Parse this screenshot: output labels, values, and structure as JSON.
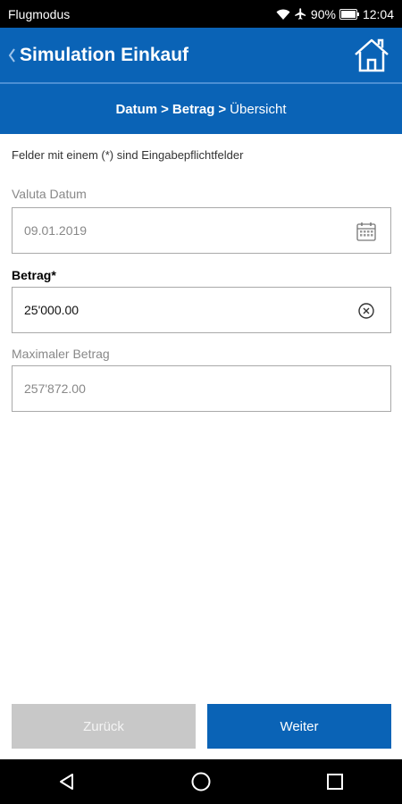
{
  "status_bar": {
    "carrier": "Flugmodus",
    "battery": "90%",
    "time": "12:04"
  },
  "header": {
    "title": "Simulation Einkauf"
  },
  "breadcrumb": {
    "step1": "Datum",
    "sep1": ">",
    "step2": "Betrag",
    "sep2": ">",
    "step3": "Übersicht"
  },
  "form": {
    "required_note": "Felder mit einem (*) sind Eingabepflichtfelder",
    "valuta_label": "Valuta Datum",
    "valuta_value": "09.01.2019",
    "betrag_label": "Betrag*",
    "betrag_value": "25'000.00",
    "max_label": "Maximaler Betrag",
    "max_value": "257'872.00"
  },
  "buttons": {
    "back": "Zurück",
    "next": "Weiter"
  },
  "colors": {
    "brand": "#0a63b6",
    "disabled": "#c8c8c8"
  },
  "icons": [
    "wifi-icon",
    "airplane-icon",
    "battery-icon",
    "back-chevron-icon",
    "home-icon",
    "calendar-icon",
    "clear-icon",
    "nav-back-icon",
    "nav-home-icon",
    "nav-recents-icon"
  ]
}
